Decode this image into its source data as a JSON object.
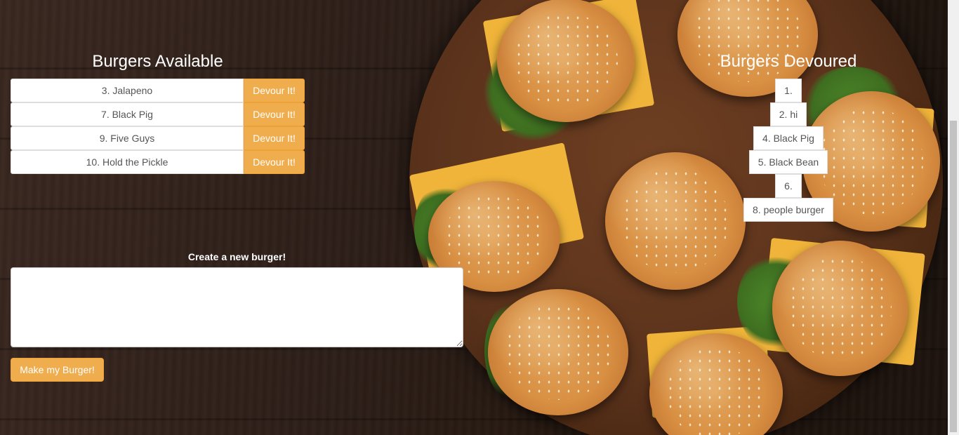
{
  "available": {
    "title": "Burgers Available",
    "button_label": "Devour It!",
    "items": [
      {
        "label": "3. Jalapeno"
      },
      {
        "label": "7. Black Pig"
      },
      {
        "label": "9. Five Guys"
      },
      {
        "label": "10. Hold the Pickle"
      }
    ]
  },
  "devoured": {
    "title": "Burgers Devoured",
    "items": [
      {
        "label": "1."
      },
      {
        "label": "2. hi"
      },
      {
        "label": "4. Black Pig"
      },
      {
        "label": "5. Black Bean"
      },
      {
        "label": "6."
      },
      {
        "label": "8. people burger"
      }
    ]
  },
  "create": {
    "label": "Create a new burger!",
    "input_value": "",
    "submit_label": "Make my Burger!"
  },
  "colors": {
    "accent": "#f0ad4e",
    "text": "#555555",
    "heading": "#ffffff"
  }
}
